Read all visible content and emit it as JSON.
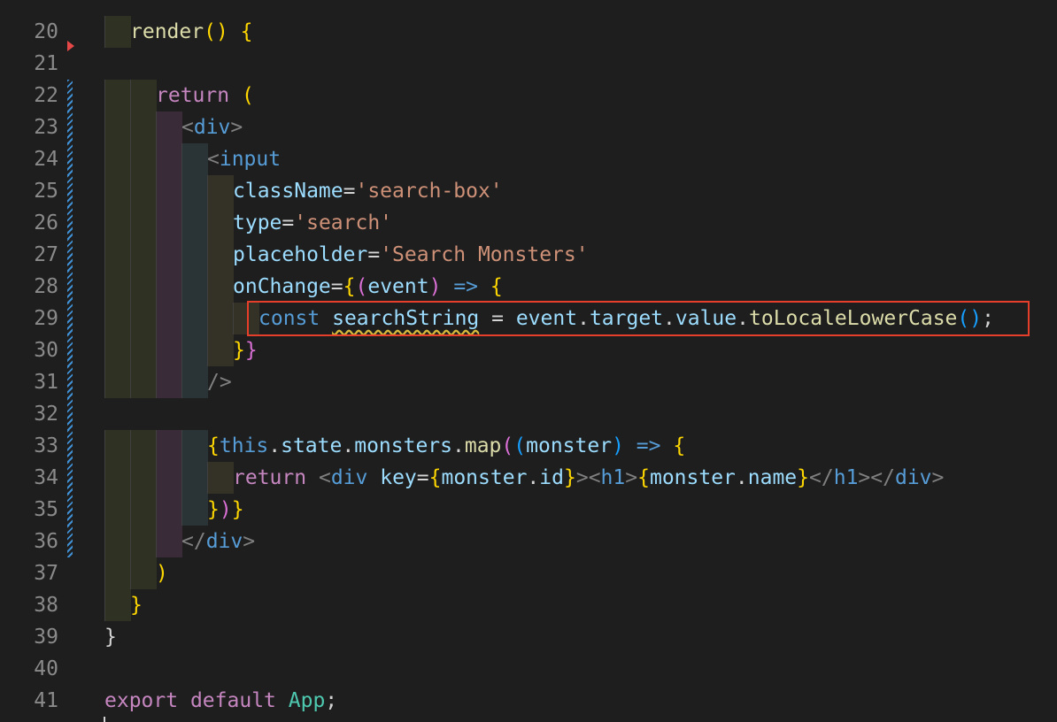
{
  "editor": {
    "colors": {
      "background": "#1e1e1e",
      "line_number": "#8a8a8a",
      "highlight_border": "#e53f2c",
      "dirty_indicator": "#3f8fd2"
    },
    "lines": [
      {
        "number": "20",
        "tokens": [
          {
            "t": "render",
            "c": "fn"
          },
          {
            "t": "()",
            "c": "b1"
          },
          {
            "t": " ",
            "c": "op"
          },
          {
            "t": "{",
            "c": "b1"
          }
        ]
      },
      {
        "number": "21",
        "tokens": []
      },
      {
        "number": "22",
        "tokens": [
          {
            "t": "return",
            "c": "kw"
          },
          {
            "t": " ",
            "c": "op"
          },
          {
            "t": "(",
            "c": "b1"
          }
        ]
      },
      {
        "number": "23",
        "tokens": [
          {
            "t": "<",
            "c": "punct"
          },
          {
            "t": "div",
            "c": "tag"
          },
          {
            "t": ">",
            "c": "punct"
          }
        ]
      },
      {
        "number": "24",
        "tokens": [
          {
            "t": "<",
            "c": "punct"
          },
          {
            "t": "input",
            "c": "tag"
          }
        ]
      },
      {
        "number": "25",
        "tokens": [
          {
            "t": "className",
            "c": "attr"
          },
          {
            "t": "=",
            "c": "op"
          },
          {
            "t": "'search-box'",
            "c": "str"
          }
        ]
      },
      {
        "number": "26",
        "tokens": [
          {
            "t": "type",
            "c": "attr"
          },
          {
            "t": "=",
            "c": "op"
          },
          {
            "t": "'search'",
            "c": "str"
          }
        ]
      },
      {
        "number": "27",
        "tokens": [
          {
            "t": "placeholder",
            "c": "attr"
          },
          {
            "t": "=",
            "c": "op"
          },
          {
            "t": "'Search Monsters'",
            "c": "str"
          }
        ]
      },
      {
        "number": "28",
        "tokens": [
          {
            "t": "onChange",
            "c": "attr"
          },
          {
            "t": "=",
            "c": "op"
          },
          {
            "t": "{",
            "c": "b1"
          },
          {
            "t": "(",
            "c": "b2"
          },
          {
            "t": "event",
            "c": "var"
          },
          {
            "t": ")",
            "c": "b2"
          },
          {
            "t": " ",
            "c": "op"
          },
          {
            "t": "=>",
            "c": "key"
          },
          {
            "t": " ",
            "c": "op"
          },
          {
            "t": "{",
            "c": "b1"
          }
        ]
      },
      {
        "number": "29",
        "tokens": [
          {
            "t": "const",
            "c": "key"
          },
          {
            "t": " ",
            "c": "op"
          },
          {
            "t": "searchString",
            "c": "var squiggle"
          },
          {
            "t": " = ",
            "c": "op"
          },
          {
            "t": "event",
            "c": "var"
          },
          {
            "t": ".",
            "c": "op"
          },
          {
            "t": "target",
            "c": "var"
          },
          {
            "t": ".",
            "c": "op"
          },
          {
            "t": "value",
            "c": "var"
          },
          {
            "t": ".",
            "c": "op"
          },
          {
            "t": "toLocaleLowerCase",
            "c": "fn"
          },
          {
            "t": "()",
            "c": "b3"
          },
          {
            "t": ";",
            "c": "op"
          }
        ]
      },
      {
        "number": "30",
        "tokens": [
          {
            "t": "}",
            "c": "b1"
          },
          {
            "t": "}",
            "c": "b2"
          }
        ]
      },
      {
        "number": "31",
        "tokens": [
          {
            "t": "/>",
            "c": "punct"
          }
        ]
      },
      {
        "number": "32",
        "tokens": []
      },
      {
        "number": "33",
        "tokens": [
          {
            "t": "{",
            "c": "b1"
          },
          {
            "t": "this",
            "c": "key"
          },
          {
            "t": ".",
            "c": "op"
          },
          {
            "t": "state",
            "c": "var"
          },
          {
            "t": ".",
            "c": "op"
          },
          {
            "t": "monsters",
            "c": "var"
          },
          {
            "t": ".",
            "c": "op"
          },
          {
            "t": "map",
            "c": "fn"
          },
          {
            "t": "(",
            "c": "b2"
          },
          {
            "t": "(",
            "c": "b3"
          },
          {
            "t": "monster",
            "c": "var"
          },
          {
            "t": ")",
            "c": "b3"
          },
          {
            "t": " ",
            "c": "op"
          },
          {
            "t": "=>",
            "c": "key"
          },
          {
            "t": " ",
            "c": "op"
          },
          {
            "t": "{",
            "c": "b1"
          }
        ]
      },
      {
        "number": "34",
        "tokens": [
          {
            "t": "return",
            "c": "kw"
          },
          {
            "t": " ",
            "c": "op"
          },
          {
            "t": "<",
            "c": "punct"
          },
          {
            "t": "div",
            "c": "tag"
          },
          {
            "t": " ",
            "c": "op"
          },
          {
            "t": "key",
            "c": "attr"
          },
          {
            "t": "=",
            "c": "op"
          },
          {
            "t": "{",
            "c": "b1"
          },
          {
            "t": "monster",
            "c": "var"
          },
          {
            "t": ".",
            "c": "op"
          },
          {
            "t": "id",
            "c": "var"
          },
          {
            "t": "}",
            "c": "b1"
          },
          {
            "t": "><",
            "c": "punct"
          },
          {
            "t": "h1",
            "c": "tag"
          },
          {
            "t": ">",
            "c": "punct"
          },
          {
            "t": "{",
            "c": "b1"
          },
          {
            "t": "monster",
            "c": "var"
          },
          {
            "t": ".",
            "c": "op"
          },
          {
            "t": "name",
            "c": "var"
          },
          {
            "t": "}",
            "c": "b1"
          },
          {
            "t": "</",
            "c": "punct"
          },
          {
            "t": "h1",
            "c": "tag"
          },
          {
            "t": "></",
            "c": "punct"
          },
          {
            "t": "div",
            "c": "tag"
          },
          {
            "t": ">",
            "c": "punct"
          }
        ]
      },
      {
        "number": "35",
        "tokens": [
          {
            "t": "}",
            "c": "b1"
          },
          {
            "t": ")",
            "c": "b2"
          },
          {
            "t": "}",
            "c": "b1"
          }
        ]
      },
      {
        "number": "36",
        "tokens": [
          {
            "t": "</",
            "c": "punct"
          },
          {
            "t": "div",
            "c": "tag"
          },
          {
            "t": ">",
            "c": "punct"
          }
        ]
      },
      {
        "number": "37",
        "tokens": [
          {
            "t": ")",
            "c": "b1"
          }
        ]
      },
      {
        "number": "38",
        "tokens": [
          {
            "t": "}",
            "c": "b1"
          }
        ]
      },
      {
        "number": "39",
        "tokens": [
          {
            "t": "}",
            "c": "op"
          }
        ]
      },
      {
        "number": "40",
        "tokens": []
      },
      {
        "number": "41",
        "tokens": [
          {
            "t": "export",
            "c": "kw"
          },
          {
            "t": " ",
            "c": "op"
          },
          {
            "t": "default",
            "c": "kw"
          },
          {
            "t": " ",
            "c": "op"
          },
          {
            "t": "App",
            "c": "type"
          },
          {
            "t": ";",
            "c": "op"
          }
        ]
      }
    ]
  }
}
